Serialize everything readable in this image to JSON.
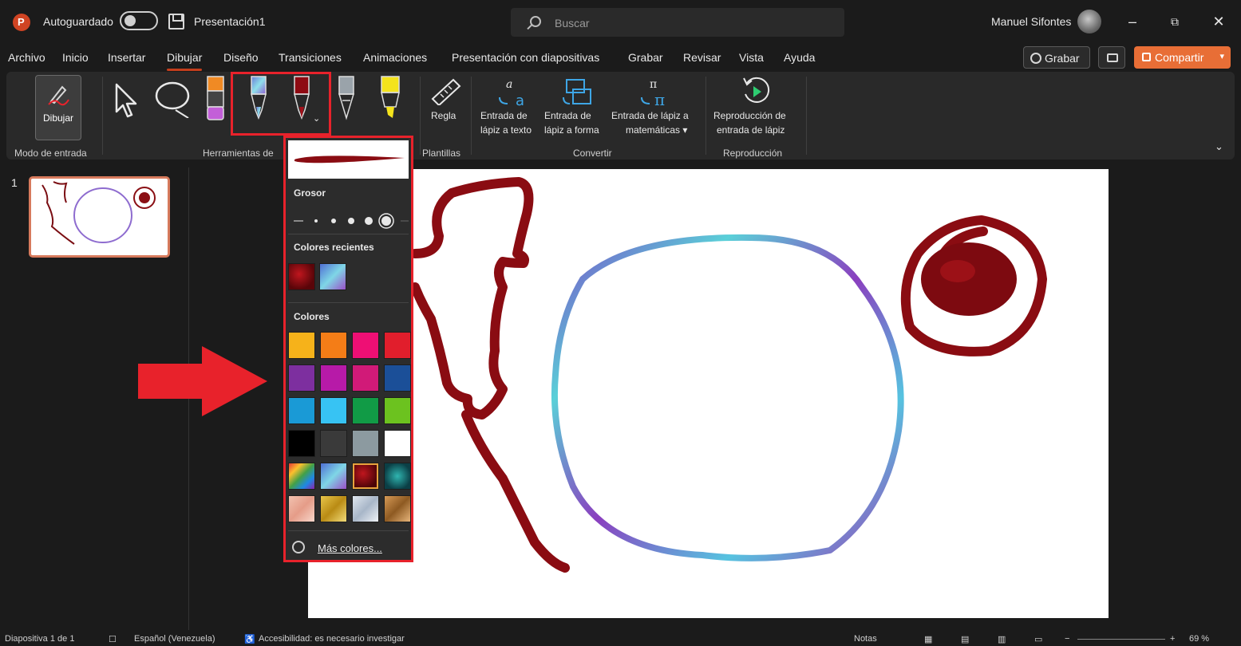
{
  "titlebar": {
    "autosave_label": "Autoguardado",
    "doc_title": "Presentación1",
    "search_placeholder": "Buscar",
    "username": "Manuel Sifontes",
    "minimize": "–",
    "restore": "⧉",
    "close": "✕"
  },
  "tabs": [
    "Archivo",
    "Inicio",
    "Insertar",
    "Dibujar",
    "Diseño",
    "Transiciones",
    "Animaciones",
    "Presentación con diapositivas",
    "Grabar",
    "Revisar",
    "Vista",
    "Ayuda"
  ],
  "active_tab": "Dibujar",
  "header_actions": {
    "record_label": "Grabar",
    "share_label": "Compartir"
  },
  "ribbon": {
    "draw_label": "Dibujar",
    "groups": {
      "input_mode": "Modo de entrada",
      "tools": "Herramientas de",
      "templates": "Plantillas",
      "convert": "Convertir",
      "replay": "Reproducción"
    },
    "ruler_label": "Regla",
    "ink_to_text": [
      "Entrada de",
      "lápiz a texto"
    ],
    "ink_to_shape": [
      "Entrada de",
      "lápiz a forma"
    ],
    "ink_to_math": [
      "Entrada de lápiz a",
      "matemáticas ▾"
    ],
    "ink_replay": [
      "Reproducción de",
      "entrada de lápiz"
    ]
  },
  "slide_panel": {
    "slide_number": "1"
  },
  "color_popup": {
    "thickness_heading": "Grosor",
    "recent_heading": "Colores recientes",
    "colors_heading": "Colores",
    "more_colors": "Más colores...",
    "recent_colors": [
      "texture-red-galaxy",
      "texture-blue-galaxy"
    ],
    "palette": [
      [
        "#f6b21a",
        "#f47d17",
        "#ee0f74",
        "#e11e2c"
      ],
      [
        "#7d2f9f",
        "#b71aa8",
        "#d11a78",
        "#1b4f98"
      ],
      [
        "#1a9ad6",
        "#37c3f3",
        "#119b46",
        "#6cc21f"
      ],
      [
        "#000000",
        "#3a3a3a",
        "#8c9aa0",
        "#ffffff"
      ],
      [
        "texture-rainbow",
        "texture-galaxy",
        "texture-red-galaxy",
        "texture-ocean"
      ],
      [
        "texture-rose-gold",
        "texture-gold",
        "texture-silver",
        "texture-bronze"
      ]
    ],
    "selected_color": "texture-red-galaxy"
  },
  "statusbar": {
    "slide_info": "Diapositiva 1 de 1",
    "language": "Español (Venezuela)",
    "accessibility": "Accesibilidad: es necesario investigar",
    "notes": "Notas",
    "zoom": "69 %"
  }
}
